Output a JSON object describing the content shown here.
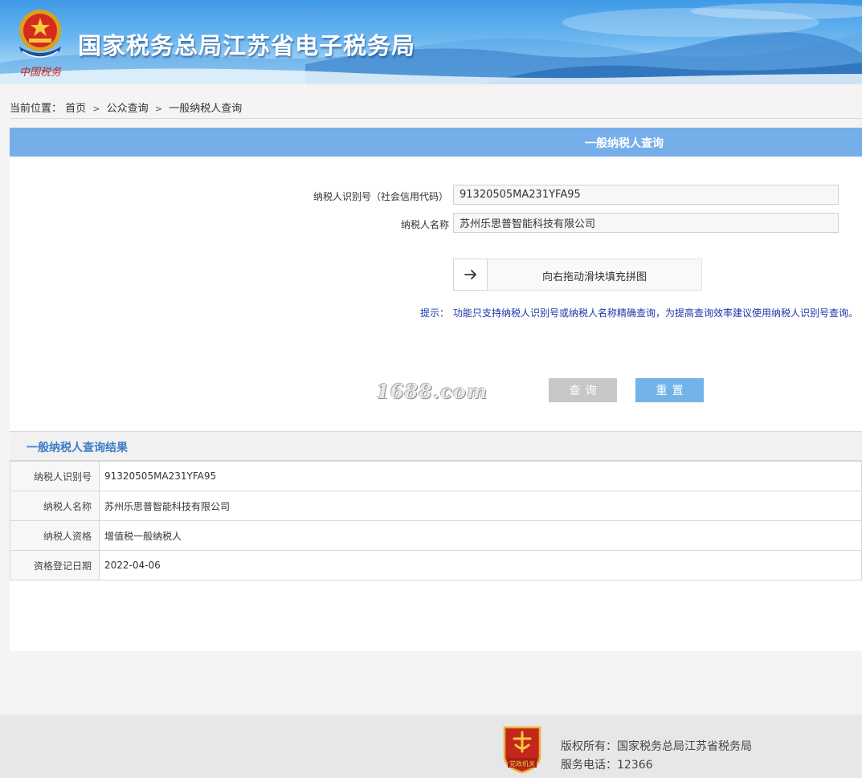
{
  "header": {
    "title": "国家税务总局江苏省电子税务局",
    "logo_caption": "中国税务"
  },
  "breadcrumb": {
    "prefix": "当前位置：",
    "items": [
      "首页",
      "公众查询",
      "一般纳税人查询"
    ],
    "separator": ">"
  },
  "query_panel": {
    "title": "一般纳税人查询",
    "fields": [
      {
        "label": "纳税人识别号（社会信用代码）",
        "value": "91320505MA231YFA95"
      },
      {
        "label": "纳税人名称",
        "value": "苏州乐思普智能科技有限公司"
      }
    ],
    "slider": {
      "icon": "arrow-right-icon",
      "text": "向右拖动滑块填充拼图"
    },
    "hint_label": "提示：",
    "hint_text": "功能只支持纳税人识别号或纳税人名称精确查询，为提高查询效率建议使用纳税人识别号查询。",
    "watermark": "1688.com",
    "buttons": {
      "query": "查询",
      "reset": "重置"
    }
  },
  "result": {
    "title": "一般纳税人查询结果",
    "rows": [
      {
        "label": "纳税人识别号",
        "value": "91320505MA231YFA95"
      },
      {
        "label": "纳税人名称",
        "value": "苏州乐思普智能科技有限公司"
      },
      {
        "label": "纳税人资格",
        "value": "增值税一般纳税人"
      },
      {
        "label": "资格登记日期",
        "value": "2022-04-06"
      }
    ]
  },
  "footer": {
    "badge_caption": "党政机关",
    "copyright": "版权所有：国家税务总局江苏省税务局",
    "phone": "服务电话：12366"
  },
  "colors": {
    "panel_header": "#76aee9",
    "reset_button": "#74b3ea",
    "query_button": "#c7c7c7",
    "result_title": "#3e7dc4",
    "hint": "#1a35a8"
  }
}
